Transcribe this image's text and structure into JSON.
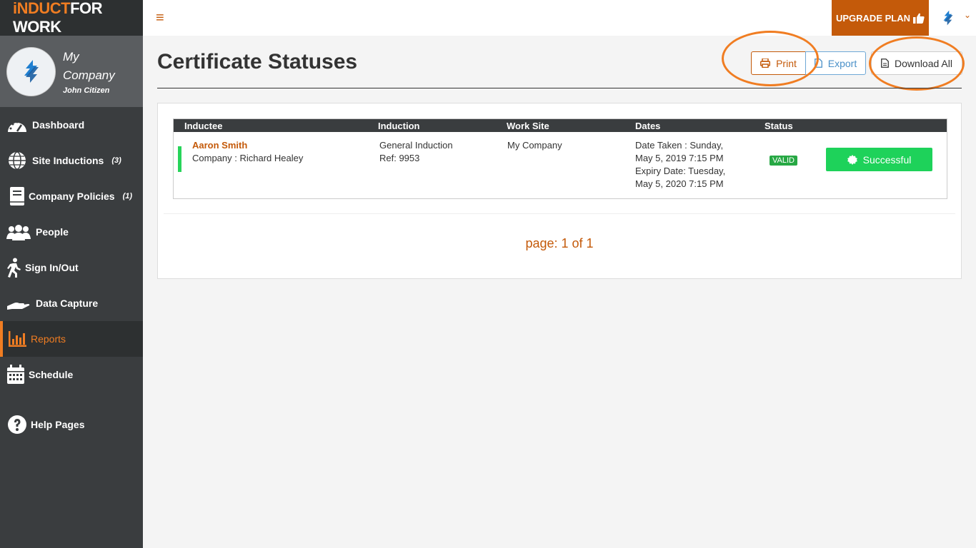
{
  "brand": {
    "logo_part1": "iNDUCT",
    "logo_part2": "FOR WORK"
  },
  "profile": {
    "company": "My Company",
    "user": "John Citizen"
  },
  "sidebar": {
    "items": [
      {
        "label": "Dashboard",
        "icon": "dashboard-gauge-icon",
        "count": ""
      },
      {
        "label": "Site Inductions",
        "icon": "globe-icon",
        "count": "(3)"
      },
      {
        "label": "Company Policies",
        "icon": "book-icon",
        "count": "(1)"
      },
      {
        "label": "People",
        "icon": "users-icon",
        "count": ""
      },
      {
        "label": "Sign In/Out",
        "icon": "walking-person-icon",
        "count": ""
      },
      {
        "label": "Data Capture",
        "icon": "hand-icon",
        "count": ""
      },
      {
        "label": "Reports",
        "icon": "bar-chart-icon",
        "count": "",
        "active": true
      },
      {
        "label": "Schedule",
        "icon": "calendar-icon",
        "count": ""
      },
      {
        "label": "Help Pages",
        "icon": "question-circle-icon",
        "count": ""
      }
    ]
  },
  "topbar": {
    "menu_glyph": "≡",
    "upgrade_label": "UPGRADE PLAN",
    "caret": "⌄"
  },
  "page": {
    "title": "Certificate Statuses",
    "buttons": {
      "print": "Print",
      "export": "Export",
      "download_all": "Download All"
    }
  },
  "table": {
    "headers": [
      "Inductee",
      "Induction",
      "Work Site",
      "Dates",
      "Status"
    ],
    "rows": [
      {
        "inductee_name": "Aaron Smith",
        "inductee_company": "Company : Richard Healey",
        "induction_name": "General Induction",
        "induction_ref": "Ref: 9953",
        "work_site": "My Company",
        "date_taken_1": "Date Taken : Sunday,",
        "date_taken_2": "May 5, 2019 7:15 PM",
        "expiry_1": "Expiry Date: Tuesday,",
        "expiry_2": "May 5, 2020 7:15 PM",
        "status_badge": "VALID",
        "result_label": "Successful"
      }
    ]
  },
  "pagination": {
    "text": "page: 1 of 1"
  },
  "colors": {
    "accent": "#f07d22",
    "accent_dark": "#c45a0a",
    "sidebar": "#3a3d3f",
    "success": "#1ed25a"
  }
}
